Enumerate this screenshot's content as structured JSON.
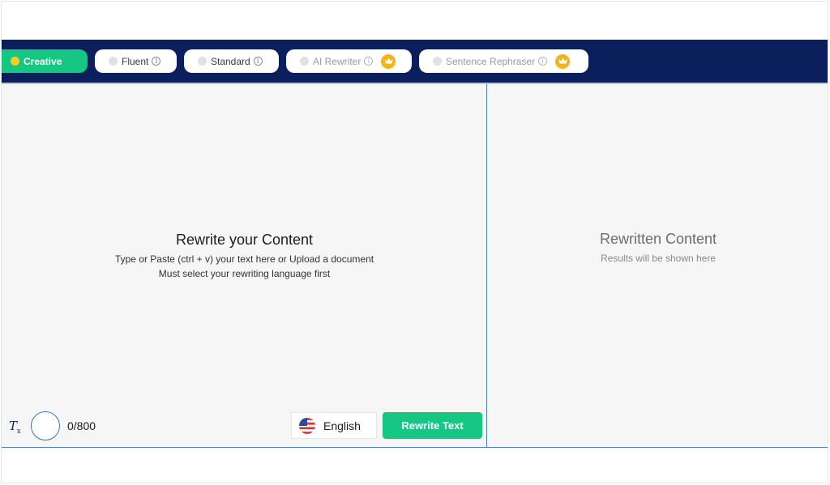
{
  "modes": [
    {
      "label": "Creative",
      "active": true,
      "pro": false
    },
    {
      "label": "Fluent",
      "active": false,
      "pro": false
    },
    {
      "label": "Standard",
      "active": false,
      "pro": false
    },
    {
      "label": "AI Rewriter",
      "active": false,
      "pro": true
    },
    {
      "label": "Sentence Rephraser",
      "active": false,
      "pro": true
    }
  ],
  "info_glyph": "i",
  "input_panel": {
    "title": "Rewrite your Content",
    "line1": "Type or Paste (ctrl + v) your text here or Upload a document",
    "line2": "Must select your rewriting language first"
  },
  "output_panel": {
    "title": "Rewritten Content",
    "subtitle": "Results will be shown here"
  },
  "toolbar": {
    "clear_format_glyph": "T",
    "clear_format_sub": "x",
    "counter": "0/800",
    "language": "English",
    "rewrite_button": "Rewrite Text"
  },
  "colors": {
    "nav_bg": "#0a1f5c",
    "accent_green": "#16c784",
    "crown_gold": "#f5b31b",
    "active_dot": "#f6cf25"
  },
  "icons": {
    "clear_format": "clear-format-icon",
    "crown": "crown-icon",
    "info": "info-icon",
    "flag": "us-flag-icon"
  }
}
